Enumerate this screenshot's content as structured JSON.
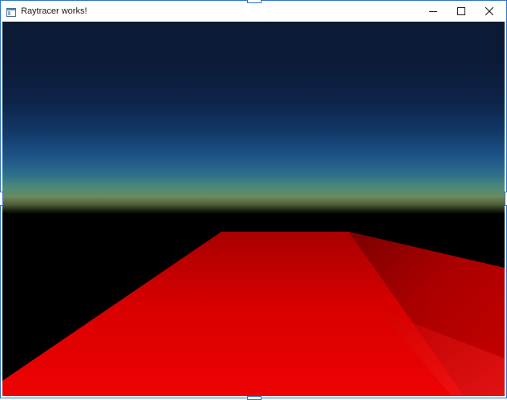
{
  "window": {
    "title": "Raytracer works!",
    "icons": {
      "app": "app-window-icon",
      "minimize": "minimize-icon",
      "maximize": "maximize-icon",
      "close": "close-icon"
    }
  },
  "render": {
    "sky_top_color": "#0c1a36",
    "sky_horizon_color": "#6c8a5c",
    "background_color": "#000000",
    "floor_color_near": "#e60000",
    "floor_color_far": "#8a0000"
  }
}
